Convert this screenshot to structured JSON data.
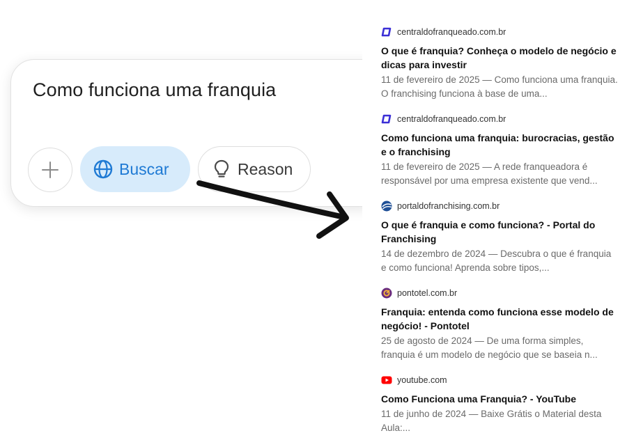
{
  "composer": {
    "query_text": "Como funciona uma franquia",
    "search_label": "Buscar",
    "reason_label": "Reason",
    "icons": {
      "plus": "plus-icon",
      "search": "globe-icon",
      "reason": "lightbulb-icon"
    },
    "colors": {
      "search_bg": "#d7ebfb",
      "search_fg": "#1f7ad4"
    }
  },
  "results": [
    {
      "domain": "centraldofranqueado.com.br",
      "favicon": "centraldofranqueado-favicon",
      "title": "O que é franquia? Conheça o modelo de negócio e dicas para investir",
      "snippet": "11 de fevereiro de 2025 — Como funciona uma franquia. O franchising funciona à base de uma..."
    },
    {
      "domain": "centraldofranqueado.com.br",
      "favicon": "centraldofranqueado-favicon",
      "title": "Como funciona uma franquia: burocracias, gestão e o franchising",
      "snippet": "11 de fevereiro de 2025 — A rede franqueadora é responsável por uma empresa existente que vend..."
    },
    {
      "domain": "portaldofranchising.com.br",
      "favicon": "portaldofranchising-favicon",
      "title": "O que é franquia e como funciona? - Portal do Franchising",
      "snippet": "14 de dezembro de 2024 — Descubra o que é franquia e como funciona! Aprenda sobre tipos,..."
    },
    {
      "domain": "pontotel.com.br",
      "favicon": "pontotel-favicon",
      "title": "Franquia: entenda como funciona esse modelo de negócio! - Pontotel",
      "snippet": "25 de agosto de 2024 — De uma forma simples, franquia é um modelo de negócio que se baseia n..."
    },
    {
      "domain": "youtube.com",
      "favicon": "youtube-favicon",
      "title": "Como Funciona uma Franquia? - YouTube",
      "snippet": "11 de junho de 2024 — Baixe Grátis o Material desta Aula:..."
    }
  ]
}
